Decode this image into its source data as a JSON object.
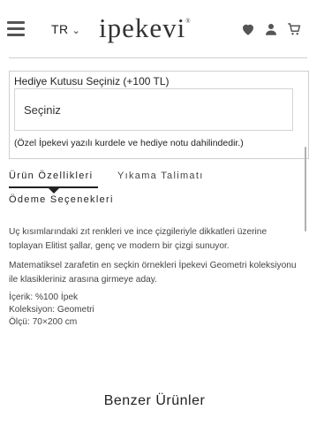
{
  "header": {
    "language": "TR",
    "logo": "ipekevi",
    "logo_mark": "®",
    "icons": [
      "menu-icon",
      "heart-icon",
      "user-icon",
      "cart-icon"
    ]
  },
  "gift": {
    "label": "Hediye Kutusu Seçiniz (+100 TL)",
    "select_value": "Seçiniz",
    "note": "(Özel İpekevi yazılı kurdele ve hediye notu dahilindedir.)"
  },
  "tabs": [
    {
      "label": "Ürün Özellikleri",
      "active": true
    },
    {
      "label": "Yıkama Talimatı",
      "active": false
    },
    {
      "label": "Ödeme Seçenekleri",
      "active": false
    }
  ],
  "description": {
    "p1": "Uç kısımlarındaki zıt renkleri ve ince çizgileriyle dikkatleri üzerine toplayan Elitist şallar, genç ve modern bir çizgi sunuyor.",
    "p2": "Matematiksel zarafetin en seçkin örnekleri İpekevi Geometri koleksiyonu ile klasikleriniz arasına girmeye aday.",
    "specs": [
      "İçerik: %100 İpek",
      "Koleksiyon: Geometri",
      "Ölçü: 70×200 cm"
    ]
  },
  "similar_title": "Benzer Ürünler",
  "colors": {
    "text": "#222222",
    "border": "#cfcfcf",
    "muted": "#444444"
  }
}
